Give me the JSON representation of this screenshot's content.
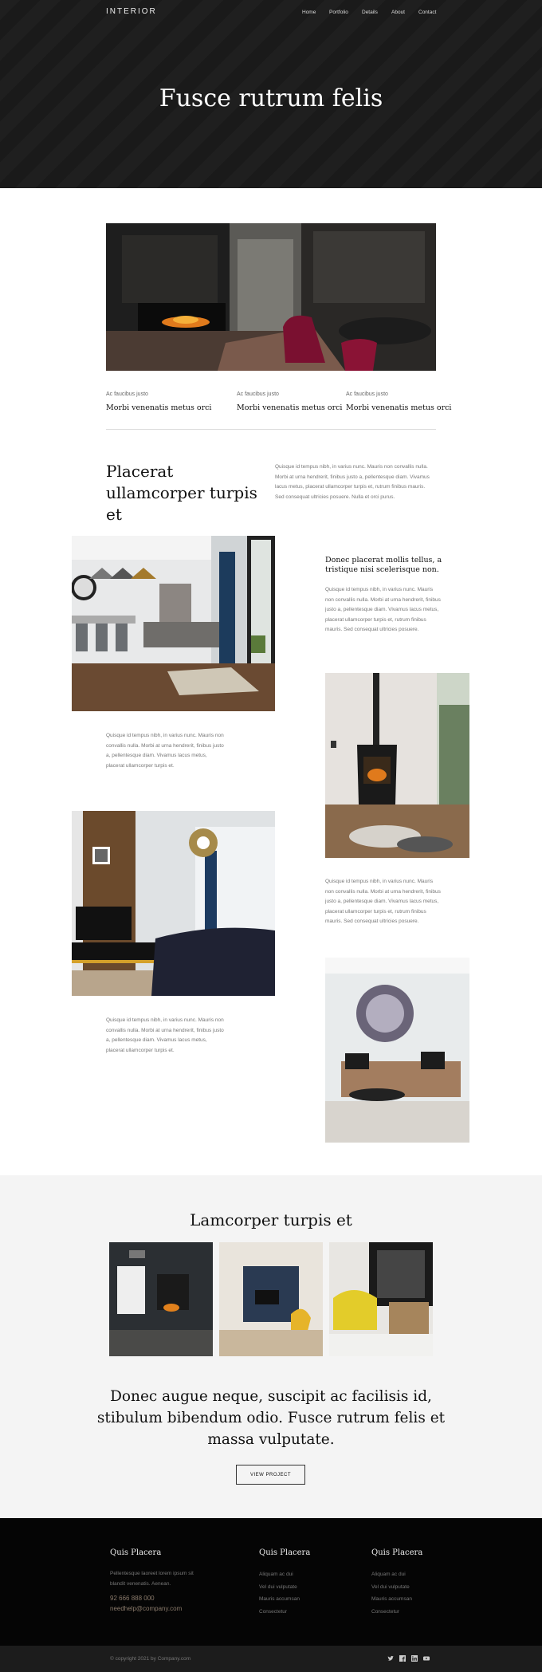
{
  "header": {
    "logo": "INTERIOR",
    "nav": [
      "Home",
      "Portfolio",
      "Details",
      "About",
      "Contact"
    ],
    "hero_title": "Fusce rutrum felis"
  },
  "features": [
    {
      "small": "Ac faucibus justo",
      "title": "Morbi venenatis metus orci"
    },
    {
      "small": "Ac faucibus justo",
      "title": "Morbi venenatis metus orci"
    },
    {
      "small": "Ac faucibus justo",
      "title": "Morbi venenatis metus orci"
    }
  ],
  "intro": {
    "title": "Placerat ullamcorper turpis et",
    "text": "Quisque id tempus nibh, in varius nunc. Mauris non convallis nulla. Morbi at urna hendrerit, finibus justo a, pellentesque diam. Vivamus lacus metus, placerat ullamcorper turpis et, rutrum finibus mauris. Sed consequat ultricies posuere. Nulla et orci purus."
  },
  "portfolio": {
    "side_title": "Donec placerat mollis tellus, a tristique nisi scelerisque non.",
    "side_text": "Quisque id tempus nibh, in varius nunc. Mauris non convallis nulla. Morbi at urna hendrerit, finibus justo a, pellentesque diam. Vivamus lacus metus, placerat ullamcorper turpis et, rutrum finibus mauris. Sed consequat ultricies posuere.",
    "caption_1": "Quisque id tempus nibh, in varius nunc. Mauris non convallis nulla. Morbi at urna hendrerit, finibus justo a, pellentesque diam. Vivamus lacus metus, placerat ullamcorper turpis et.",
    "caption_2": "Quisque id tempus nibh, in varius nunc. Mauris non convallis nulla. Morbi at urna hendrerit, finibus justo a, pellentesque diam. Vivamus lacus metus, placerat ullamcorper turpis et, rutrum finibus mauris. Sed consequat ultricies posuere.",
    "caption_3": "Quisque id tempus nibh, in varius nunc. Mauris non convallis nulla. Morbi at urna hendrerit, finibus justo a, pellentesque diam. Vivamus lacus metus, placerat ullamcorper turpis et."
  },
  "gallery": {
    "title": "Lamcorper turpis et",
    "quote": "Donec augue neque, suscipit ac facilisis id, stibulum bibendum odio. Fusce rutrum felis et massa vulputate.",
    "button": "VIEW PROJECT"
  },
  "footer": {
    "col1": {
      "title": "Quis Placera",
      "text": "Pellentesque laoreet lorem ipsum sit blandit venenatis. Aenean.",
      "phone": "92 666 888 000",
      "email": "needhelp@company.com"
    },
    "col2": {
      "title": "Quis Placera",
      "items": [
        "Aliquam ac dui",
        "Vel dui vulputate",
        "Mauris accumsan",
        "Consectetur"
      ]
    },
    "col3": {
      "title": "Quis Placera",
      "items": [
        "Aliquam ac dui",
        "Vel dui vulputate",
        "Mauris accumsan",
        "Consectetur"
      ]
    },
    "copyright": "© copyright 2021 by Company.com",
    "socials": [
      "twitter-icon",
      "facebook-icon",
      "linkedin-icon",
      "youtube-icon"
    ]
  },
  "colors": {
    "hero_bg": "#1b1b1b",
    "footer_bg": "#050505",
    "grey_section": "#f4f4f4",
    "accent": "#8a7a6b"
  }
}
